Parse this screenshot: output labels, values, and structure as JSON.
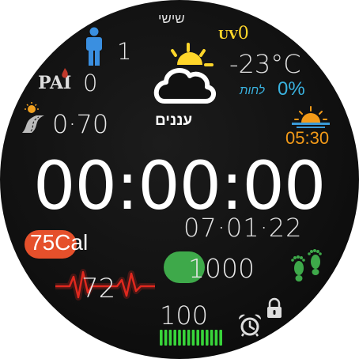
{
  "watchface": {
    "day_label": "שישי",
    "uv": {
      "label": "UV",
      "value": "0"
    },
    "steps_active": {
      "value": "1",
      "icon": "person-icon"
    },
    "pai": {
      "label": "PAI",
      "value": "0"
    },
    "distance": {
      "value": "0·70",
      "icon": "road-icon"
    },
    "weather": {
      "icon": "partly-cloudy-icon",
      "temperature": "-23°C",
      "humidity_label": "לחות",
      "humidity_value": "0%",
      "condition": "עננים"
    },
    "sunset": {
      "time": "05:30",
      "icon": "sunset-icon"
    },
    "time": "00:00:00",
    "date": "07·01·22",
    "calories": {
      "value": "75",
      "unit": "Cal",
      "pill_color": "#e5502b"
    },
    "step_goal": {
      "value": "1000",
      "pill_color": "#3ea94a",
      "icon": "footprints-icon"
    },
    "heart_rate": {
      "value": "72",
      "icon": "heartbeat-icon"
    },
    "battery": {
      "value": "100",
      "level_percent": 100,
      "icon": "battery-bars-icon"
    },
    "alarm_icon": "alarm-clock-icon",
    "lock_icon": "lock-icon",
    "colors": {
      "uv": "#ffd62a",
      "humidity": "#3ab3e0",
      "sunset": "#f39a18",
      "calories": "#e5502b",
      "steps": "#3ea94a",
      "heart": "#e0281e",
      "battery": "#38d43a",
      "person": "#3a8fe0"
    }
  }
}
